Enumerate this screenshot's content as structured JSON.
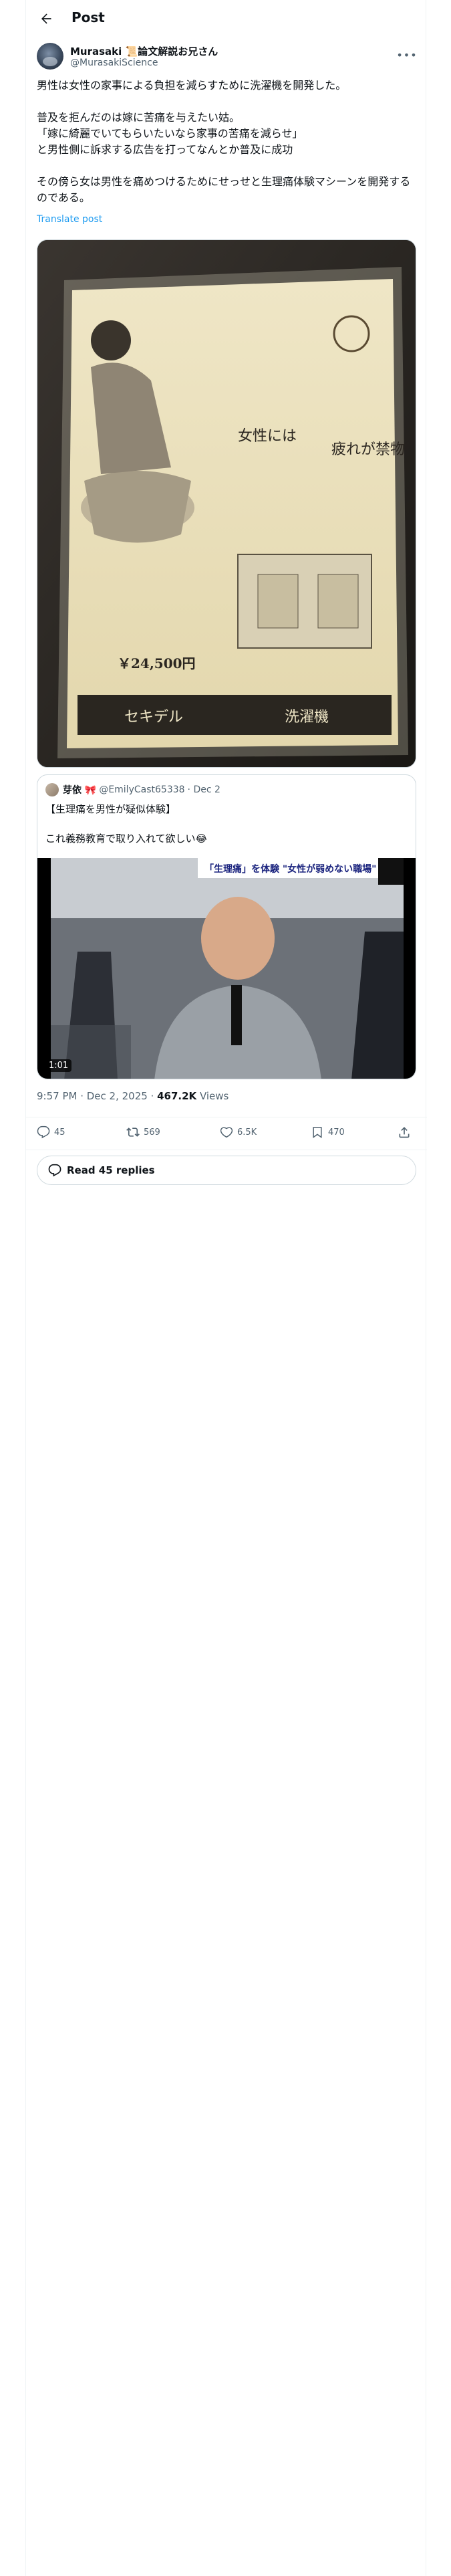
{
  "header": {
    "title": "Post"
  },
  "tweet": {
    "author_name": "Murasaki 📜論文解説お兄さん",
    "author_handle": "@MurasakiScience",
    "body": [
      "男性は女性の家事による負担を減らすために洗濯機を開発した。",
      "",
      "普及を拒んだのは嫁に苦痛を与えたい姑。",
      "「嫁に綺麗でいてもらいたいなら家事の苦痛を減らせ」",
      "と男性側に訴求する広告を打ってなんとか普及に成功",
      "",
      "その傍ら女は男性を痛めつけるためにせっせと生理痛体験マシーンを開発するのである。"
    ],
    "translate_label": "Translate post",
    "poster": {
      "headline_a": "女性には",
      "headline_b": "疲れが禁物",
      "price": "￥24,500円",
      "brand": "セキデル",
      "product": "洗濯機"
    },
    "quote": {
      "name": "芽依 🎀",
      "handle": "@EmilyCast65338",
      "date": "· Dec 2",
      "text": [
        "【生理痛を男性が疑似体験】",
        "",
        "これ義務教育で取り入れて欲しい😂"
      ],
      "video_caption": "「生理痛」を体験 \"女性が弱めない職場\"",
      "video_duration": "1:01"
    },
    "timestamp": "9:57 PM · Dec 2, 2025 · ",
    "views_count": "467.2K",
    "views_label": " Views",
    "actions": {
      "replies": "45",
      "reposts": "569",
      "likes": "6.5K",
      "bookmarks": "470"
    },
    "read_replies_label": "Read 45 replies"
  },
  "colors": {
    "accent": "#1d9bf0",
    "text_secondary": "#536471",
    "border": "#cfd9de"
  }
}
